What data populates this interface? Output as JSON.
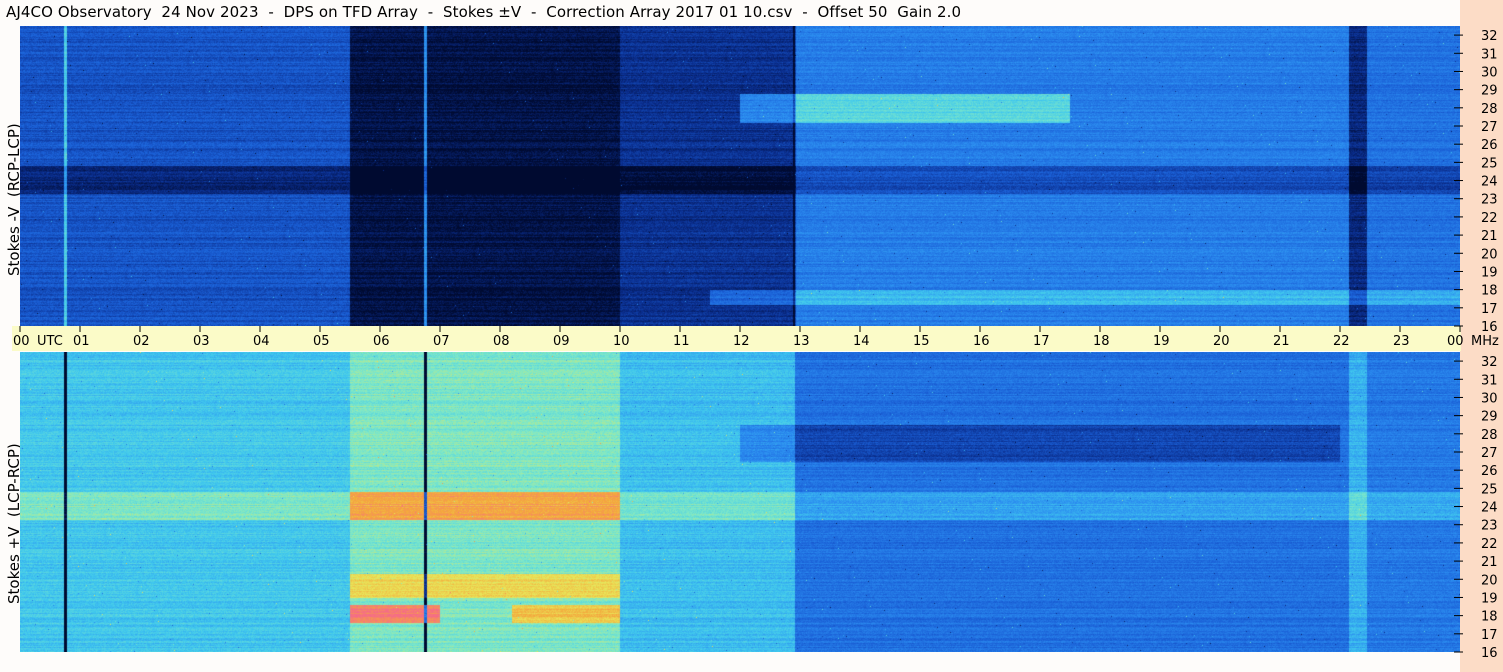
{
  "title": "AJ4CO Observatory  24 Nov 2023  -  DPS on TFD Array  -  Stokes ±V  -  Correction Array 2017 01 10.csv  -  Offset 50  Gain 2.0",
  "colors": {
    "background": "#fefcfa",
    "axis_band": "#fbfbc8",
    "right_strip": "#fcdcc6",
    "colormap": [
      "#000a30",
      "#0a2d8c",
      "#1a5fd6",
      "#2b8cf0",
      "#40c8ee",
      "#7ee8c8",
      "#e8e85a",
      "#f4a83c",
      "#f56a8a"
    ]
  },
  "chart_data": [
    {
      "type": "heatmap",
      "title": "Stokes -V (RCP-LCP)",
      "ylabel": "Stokes -V  (RCP-LCP)",
      "x_ticks": [
        "00",
        "01",
        "02",
        "03",
        "04",
        "05",
        "06",
        "07",
        "08",
        "09",
        "10",
        "11",
        "12",
        "13",
        "14",
        "15",
        "16",
        "17",
        "18",
        "19",
        "20",
        "21",
        "22",
        "23",
        "00"
      ],
      "x_unit": "UTC",
      "y_ticks": [
        "16",
        "17",
        "18",
        "19",
        "20",
        "21",
        "22",
        "23",
        "24",
        "25",
        "26",
        "27",
        "28",
        "29",
        "30",
        "31",
        "32"
      ],
      "y_unit": "MHz",
      "xlim": [
        0,
        24
      ],
      "ylim": [
        16,
        32.5
      ],
      "segments": [
        {
          "x": [
            0,
            5.5
          ],
          "level": 0.22
        },
        {
          "x": [
            5.5,
            10.0
          ],
          "level": 0.03
        },
        {
          "x": [
            10.0,
            12.9
          ],
          "level": 0.13
        },
        {
          "x": [
            12.9,
            22.15
          ],
          "level": 0.33
        },
        {
          "x": [
            22.15,
            22.45
          ],
          "level": 0.1
        },
        {
          "x": [
            22.45,
            24
          ],
          "level": 0.3
        }
      ],
      "bands": [
        {
          "y": [
            23.3,
            24.8
          ],
          "delta": -0.12
        },
        {
          "y": [
            27.2,
            28.8
          ],
          "delta": 0.22,
          "x": [
            12.0,
            17.5
          ]
        },
        {
          "y": [
            17.2,
            18.0
          ],
          "delta": 0.15,
          "x": [
            11.5,
            24
          ]
        }
      ],
      "vlines": [
        {
          "x": 0.75,
          "delta": 0.3
        },
        {
          "x": 6.75,
          "delta": 0.35
        },
        {
          "x": 12.9,
          "delta": -0.15
        }
      ]
    },
    {
      "type": "heatmap",
      "title": "Stokes +V (LCP-RCP)",
      "ylabel": "Stokes +V  (LCP-RCP)",
      "x_ticks": [
        "00",
        "01",
        "02",
        "03",
        "04",
        "05",
        "06",
        "07",
        "08",
        "09",
        "10",
        "11",
        "12",
        "13",
        "14",
        "15",
        "16",
        "17",
        "18",
        "19",
        "20",
        "21",
        "22",
        "23",
        "00"
      ],
      "x_unit": "UTC",
      "y_ticks": [
        "16",
        "17",
        "18",
        "19",
        "20",
        "21",
        "22",
        "23",
        "24",
        "25",
        "26",
        "27",
        "28",
        "29",
        "30",
        "31",
        "32"
      ],
      "y_unit": "MHz",
      "xlim": [
        0,
        24
      ],
      "ylim": [
        16,
        32.5
      ],
      "segments": [
        {
          "x": [
            0,
            5.5
          ],
          "level": 0.5
        },
        {
          "x": [
            5.5,
            10.0
          ],
          "level": 0.62
        },
        {
          "x": [
            10.0,
            12.9
          ],
          "level": 0.48
        },
        {
          "x": [
            12.9,
            22.15
          ],
          "level": 0.3
        },
        {
          "x": [
            22.15,
            22.45
          ],
          "level": 0.45
        },
        {
          "x": [
            22.45,
            24
          ],
          "level": 0.32
        }
      ],
      "bands": [
        {
          "y": [
            23.3,
            24.8
          ],
          "delta": 0.12
        },
        {
          "y": [
            23.3,
            24.8
          ],
          "delta": 0.14,
          "x": [
            5.5,
            10.0
          ]
        },
        {
          "y": [
            19.0,
            20.3
          ],
          "delta": 0.16,
          "x": [
            5.5,
            10.0
          ]
        },
        {
          "y": [
            17.6,
            18.6
          ],
          "delta": 0.34,
          "x": [
            5.5,
            7.0
          ]
        },
        {
          "y": [
            17.6,
            18.6
          ],
          "delta": 0.2,
          "x": [
            8.2,
            10.0
          ]
        },
        {
          "y": [
            26.5,
            28.5
          ],
          "delta": -0.12,
          "x": [
            12.0,
            22.0
          ]
        }
      ],
      "vlines": [
        {
          "x": 0.75,
          "delta": -0.6
        },
        {
          "x": 6.75,
          "delta": -0.65
        }
      ]
    }
  ]
}
